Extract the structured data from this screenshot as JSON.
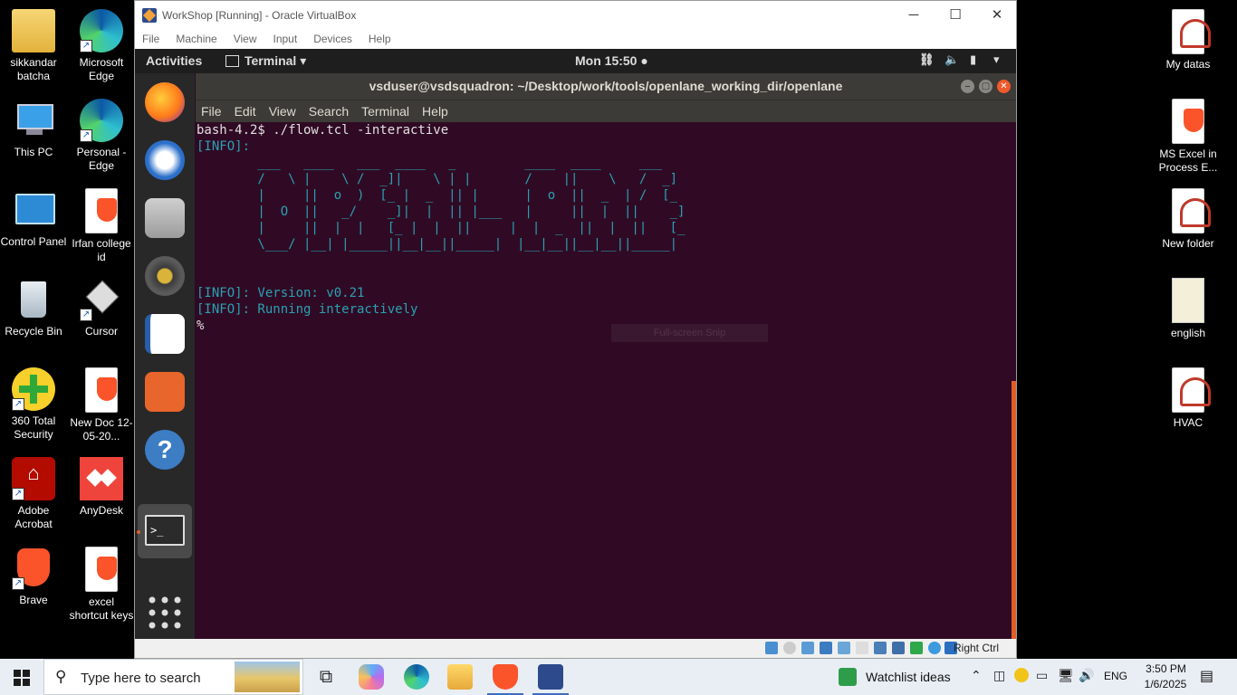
{
  "desktop_left": [
    {
      "label": "sikkandar batcha",
      "icon": "user-folder-icon"
    },
    {
      "label": "Microsoft Edge",
      "icon": "edge-icon"
    },
    {
      "label": "This PC",
      "icon": "computer-icon"
    },
    {
      "label": "Personal - Edge",
      "icon": "edge-profile-icon"
    },
    {
      "label": "Control Panel",
      "icon": "control-panel-icon"
    },
    {
      "label": "Irfan college id",
      "icon": "brave-document-icon"
    },
    {
      "label": "Recycle Bin",
      "icon": "recycle-bin-icon"
    },
    {
      "label": "Cursor",
      "icon": "cursor-app-icon"
    },
    {
      "label": "360 Total Security",
      "icon": "security-icon"
    },
    {
      "label": "New Doc 12-05-20...",
      "icon": "brave-document-icon"
    },
    {
      "label": "Adobe Acrobat",
      "icon": "acrobat-icon"
    },
    {
      "label": "AnyDesk",
      "icon": "anydesk-icon"
    },
    {
      "label": "Brave",
      "icon": "brave-icon"
    },
    {
      "label": "excel shortcut keys",
      "icon": "brave-document-icon"
    }
  ],
  "desktop_right": [
    {
      "label": "My datas",
      "icon": "pdf-icon"
    },
    {
      "label": "MS Excel in Process E...",
      "icon": "brave-document-icon"
    },
    {
      "label": "New folder",
      "icon": "pdf-icon"
    },
    {
      "label": "english",
      "icon": "document-icon"
    },
    {
      "label": "HVAC",
      "icon": "pdf-icon"
    }
  ],
  "vbox": {
    "title": "WorkShop [Running] - Oracle VirtualBox",
    "menu": [
      "File",
      "Machine",
      "View",
      "Input",
      "Devices",
      "Help"
    ],
    "host_key": "Right Ctrl"
  },
  "gnome": {
    "activities": "Activities",
    "app_menu": "Terminal ▾",
    "clock": "Mon 15:50 ●"
  },
  "terminal": {
    "title": "vsduser@vsdsquadron: ~/Desktop/work/tools/openlane_working_dir/openlane",
    "menu": [
      "File",
      "Edit",
      "View",
      "Search",
      "Terminal",
      "Help"
    ],
    "lines": [
      {
        "text": "bash-4.2$ ./flow.tcl -interactive",
        "color": "#e0e0e0"
      },
      {
        "text": "[INFO]:",
        "color": "#2aa1b3"
      },
      {
        "text": "        ___   ____   ___  ____   _         ____  ____     ___",
        "color": "#2aa1b3"
      },
      {
        "text": "        /   \\ |    \\ /  _]|    \\ | |       /    ||    \\   /  _]",
        "color": "#2aa1b3"
      },
      {
        "text": "        |     ||  o  )  [_ |  _  || |      |  o  ||  _  | /  [_",
        "color": "#2aa1b3"
      },
      {
        "text": "        |  O  ||   _/    _]|  |  || |___   |     ||  |  ||    _]",
        "color": "#2aa1b3"
      },
      {
        "text": "        |     ||  |  |   [_ |  |  ||     |  |  _  ||  |  ||   [_",
        "color": "#2aa1b3"
      },
      {
        "text": "        \\___/ |__| |_____||__|__||_____|  |__|__||__|__||_____|",
        "color": "#2aa1b3"
      },
      {
        "text": "",
        "color": "#e0e0e0"
      },
      {
        "text": "",
        "color": "#e0e0e0"
      },
      {
        "text": "[INFO]: Version: v0.21",
        "color": "#2aa1b3"
      },
      {
        "text": "[INFO]: Running interactively",
        "color": "#2aa1b3"
      },
      {
        "text": "%",
        "color": "#e0e0e0"
      }
    ],
    "snip_tooltip": "Full-screen Snip"
  },
  "taskbar": {
    "search_placeholder": "Type here to search",
    "watchlist": "Watchlist ideas",
    "language": "ENG",
    "time": "3:50 PM",
    "date": "1/6/2025"
  }
}
